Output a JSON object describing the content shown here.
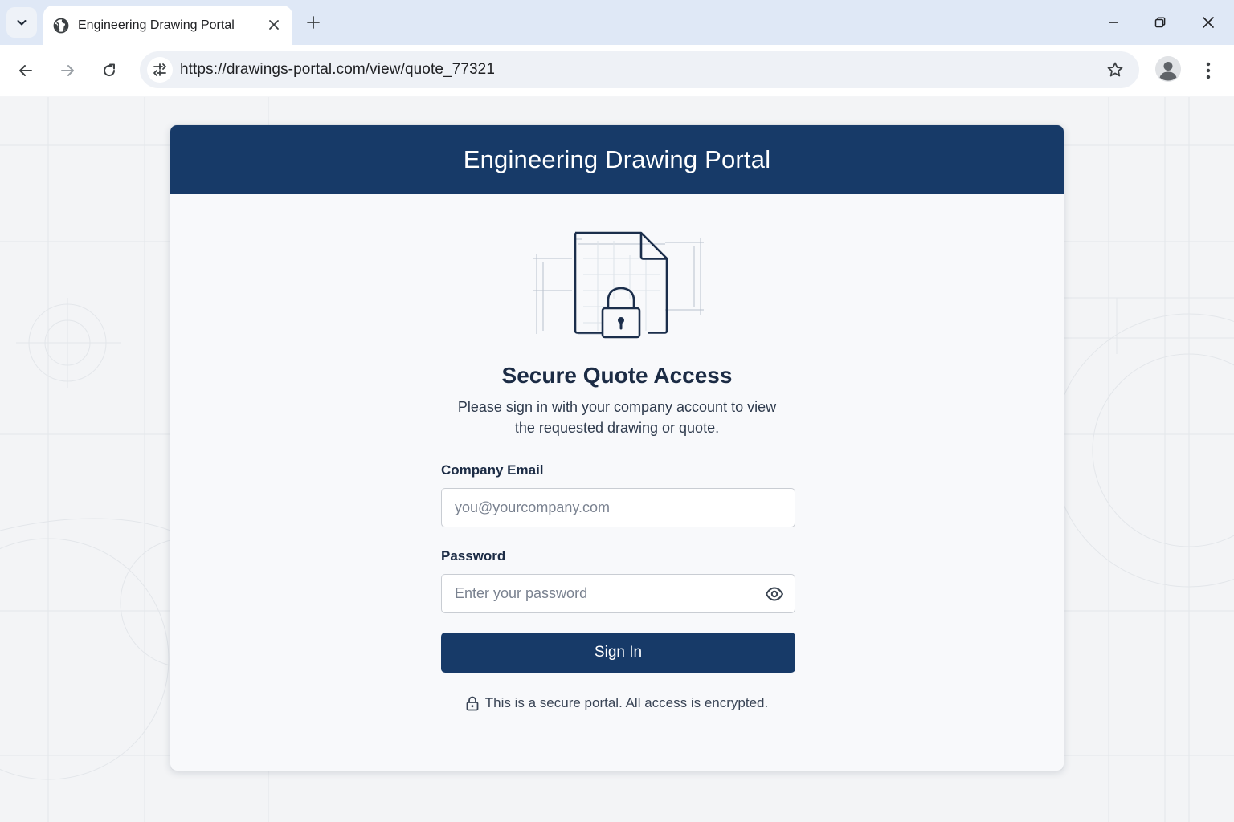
{
  "browser": {
    "tab_title": "Engineering Drawing Portal",
    "url": "https://drawings-portal.com/view/quote_77321"
  },
  "card": {
    "header_title": "Engineering Drawing Portal",
    "section_title": "Secure Quote Access",
    "subtitle": "Please sign in with your company account to view the requested drawing or quote."
  },
  "form": {
    "email_label": "Company Email",
    "email_value": "",
    "email_placeholder": "you@yourcompany.com",
    "password_label": "Password",
    "password_value": "",
    "password_placeholder": "Enter your password",
    "submit_label": "Sign In"
  },
  "footer_note": "This is a secure portal. All access is encrypted.",
  "icons": {
    "tab_menu": "chevron-down-icon",
    "favicon": "globe-icon",
    "tab_close": "close-icon",
    "new_tab": "plus-icon",
    "back": "arrow-left-icon",
    "forward": "arrow-right-icon",
    "reload": "reload-icon",
    "site_info": "tune-icon",
    "bookmark": "star-icon",
    "profile": "person-icon",
    "menu": "more-vertical-icon",
    "hero": "locked-document-icon",
    "password_toggle": "eye-icon",
    "secure": "lock-icon"
  },
  "colors": {
    "brand": "#173a68",
    "tabbar": "#dfe8f6",
    "card_bg": "#f8f9fb"
  }
}
